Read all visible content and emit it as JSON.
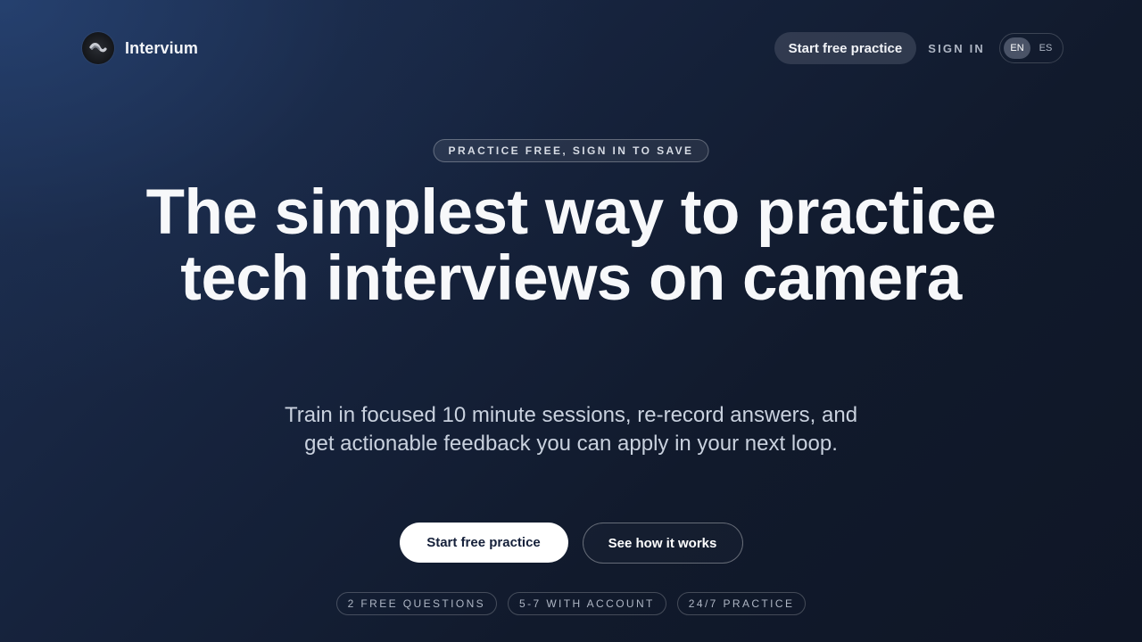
{
  "header": {
    "brand_name": "Intervium",
    "logo_icon": "intervium-logo-icon",
    "cta_label": "Start free practice",
    "signin_label": "SIGN IN",
    "languages": [
      {
        "code": "EN",
        "active": true
      },
      {
        "code": "ES",
        "active": false
      }
    ]
  },
  "hero": {
    "badge": "PRACTICE FREE, SIGN IN TO SAVE",
    "headline": "The simplest way to practice tech interviews on camera",
    "subtitle": "Train in focused 10 minute sessions, re-record answers, and get actionable feedback you can apply in your next loop.",
    "primary_cta": "Start free practice",
    "secondary_cta": "See how it works",
    "chips": [
      "2 FREE QUESTIONS",
      "5-7 WITH ACCOUNT",
      "24/7 PRACTICE"
    ]
  },
  "colors": {
    "background_start": "#1d2f52",
    "background_end": "#0f1626",
    "primary_button": "#ffffff",
    "primary_button_text": "#15203a"
  }
}
